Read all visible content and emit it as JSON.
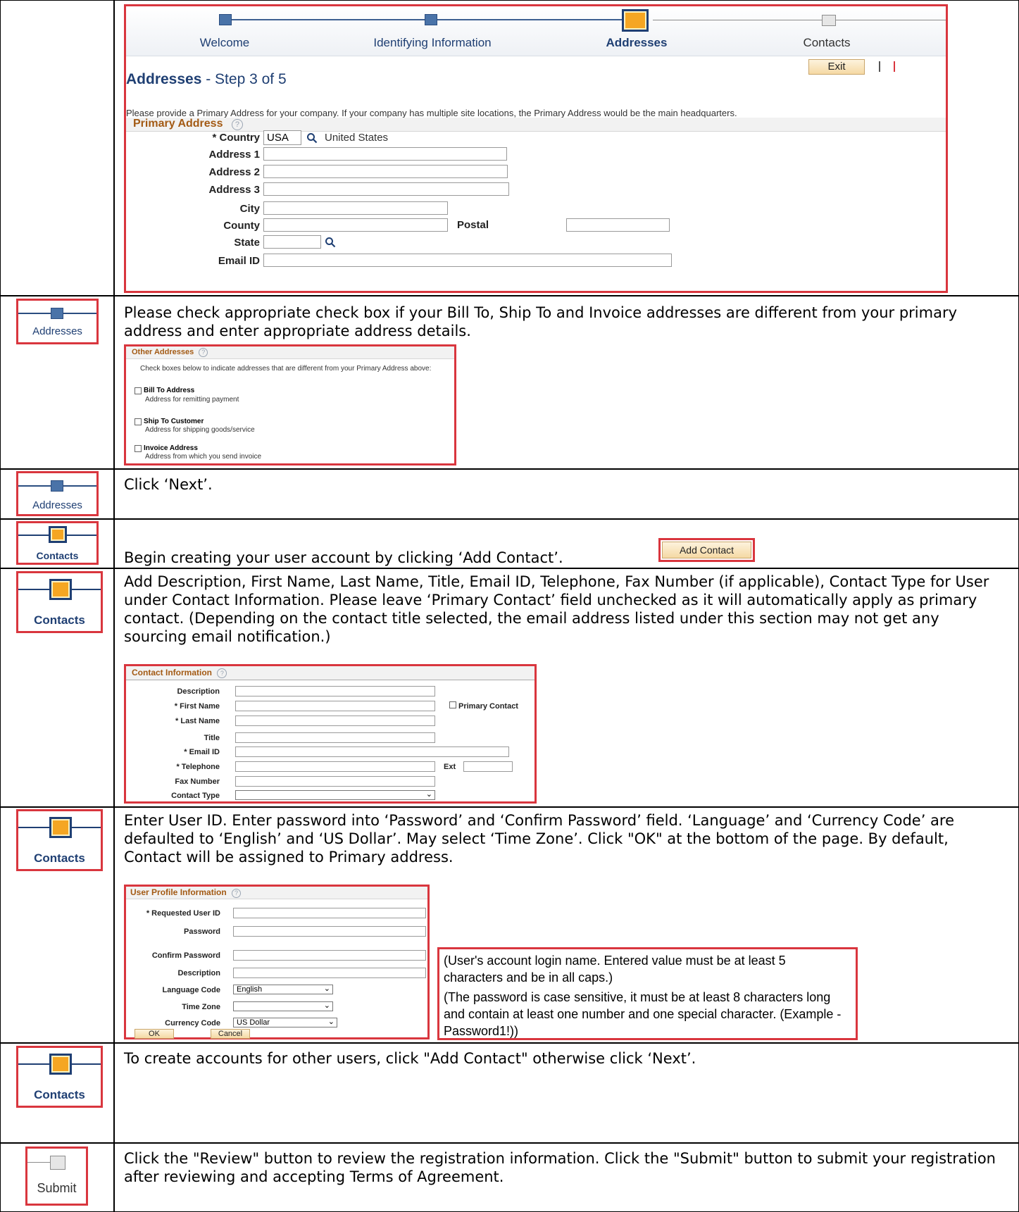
{
  "wizard": {
    "steps": [
      "Welcome",
      "Identifying Information",
      "Addresses",
      "Contacts"
    ],
    "exit_label": "Exit",
    "page_title": "Addresses",
    "page_step": " - Step 3 of 5",
    "instructions": "Please provide a Primary Address for your company. If your company has multiple site locations, the Primary Address would be the main headquarters.",
    "primary_address_header": "Primary Address",
    "country_label": "* Country",
    "country_value": "USA",
    "country_name": "United States",
    "address1_label": "Address 1",
    "address2_label": "Address 2",
    "address3_label": "Address 3",
    "city_label": "City",
    "county_label": "County",
    "postal_label": "Postal",
    "state_label": "State",
    "email_label": "Email ID"
  },
  "rows": {
    "other_addresses_text": "Please check appropriate check box if your Bill To, Ship To and Invoice addresses are different from your primary address and enter appropriate address details.",
    "next_text": "Click ‘Next’.",
    "add_contact_text": "Begin creating your user account by clicking ‘Add Contact’.",
    "contact_info_text": "Add Description, First Name, Last Name, Title, Email ID, Telephone, Fax Number (if applicable), Contact Type for User under Contact Information. Please leave ‘Primary Contact’ field unchecked as it will automatically apply as primary contact. (Depending on the contact title selected, the email address listed under this section may not get any sourcing email notification.)",
    "user_profile_text": "Enter User ID. Enter password into ‘Password’ and ‘Confirm Password’ field. ‘Language’ and ‘Currency Code’ are defaulted to ‘English’ and ‘US Dollar’. May select ‘Time Zone’.  Click \"OK\" at the bottom of the page. By default, Contact will be assigned to Primary address.",
    "other_users_text": "To create accounts for other users, click \"Add Contact\" otherwise click ‘Next’.",
    "review_text": "Click the \"Review\" button to review the registration information. Click the \"Submit\" button to submit your registration after reviewing and accepting Terms of Agreement."
  },
  "step_icons": {
    "addresses": "Addresses",
    "contacts": "Contacts",
    "submit": "Submit"
  },
  "other_addresses": {
    "header": "Other Addresses",
    "hint": "Check boxes below to indicate addresses that are different from your Primary Address above:",
    "items": [
      {
        "label": "Bill To Address",
        "desc": "Address for remitting payment"
      },
      {
        "label": "Ship To Customer",
        "desc": "Address for shipping goods/service"
      },
      {
        "label": "Invoice Address",
        "desc": "Address from which you send invoice"
      }
    ]
  },
  "add_contact_button": "Add Contact",
  "contact_information": {
    "header": "Contact Information",
    "description": "Description",
    "first_name": "* First Name",
    "last_name": "* Last Name",
    "title": "Title",
    "email": "* Email ID",
    "telephone": "* Telephone",
    "ext": "Ext",
    "fax": "Fax Number",
    "contact_type": "Contact Type",
    "primary_contact": "Primary Contact"
  },
  "user_profile": {
    "header": "User Profile Information",
    "user_id": "* Requested User ID",
    "password": "Password",
    "confirm_password": "Confirm Password",
    "description": "Description",
    "language_label": "Language Code",
    "language_value": "English",
    "timezone_label": "Time Zone",
    "timezone_value": "",
    "currency_label": "Currency Code",
    "currency_value": "US Dollar",
    "ok": "OK",
    "cancel": "Cancel"
  },
  "notes": {
    "user_id_note": "(User's account login name. Entered value must be at least 5 characters and be in all caps.)",
    "password_note": "(The password is case sensitive, it must be at least 8 characters long and contain at least one number and one special character. (Example - Password1!))"
  },
  "colors": {
    "highlight": "#d9363e",
    "accent_blue": "#1f3f73",
    "accent_orange": "#f5a623",
    "section_title": "#a35a14"
  }
}
